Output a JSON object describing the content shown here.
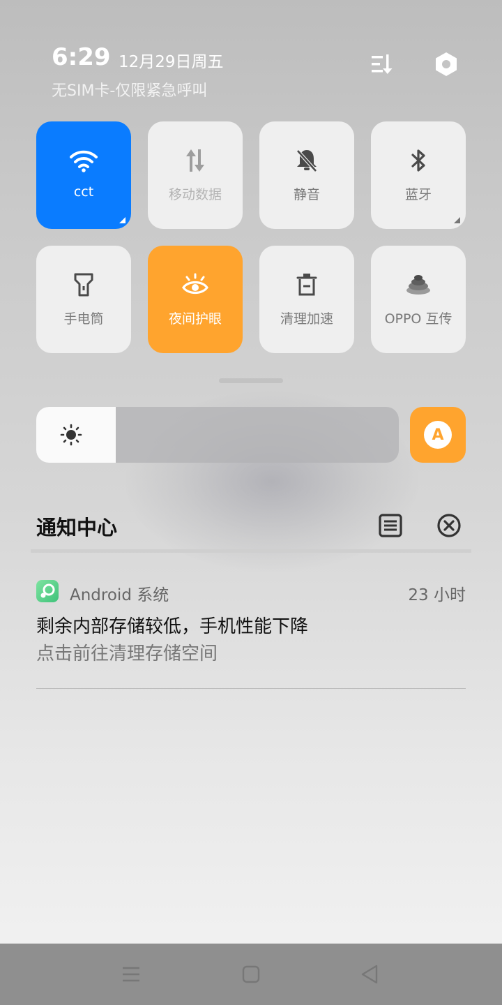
{
  "status": {
    "time": "6:29",
    "date": "12月29日周五",
    "carrier": "无SIM卡-仅限紧急呼叫",
    "icons": [
      "edit-sort-icon",
      "settings-gear-icon"
    ]
  },
  "tiles": [
    {
      "label": "cct",
      "icon": "wifi-icon",
      "state": "active-blue"
    },
    {
      "label": "移动数据",
      "icon": "mobile-data-icon",
      "state": "disabled"
    },
    {
      "label": "静音",
      "icon": "mute-bell-icon",
      "state": "off"
    },
    {
      "label": "蓝牙",
      "icon": "bluetooth-icon",
      "state": "off"
    },
    {
      "label": "手电筒",
      "icon": "flashlight-icon",
      "state": "off"
    },
    {
      "label": "夜间护眼",
      "icon": "eye-protection-icon",
      "state": "active-orange"
    },
    {
      "label": "清理加速",
      "icon": "trash-icon",
      "state": "off"
    },
    {
      "label": "OPPO 互传",
      "icon": "oppo-share-icon",
      "state": "off"
    }
  ],
  "brightness": {
    "level": 0.22,
    "auto_label": "A"
  },
  "notification_center": {
    "title": "通知中心",
    "icons": [
      "manage-notifications-icon",
      "clear-all-icon"
    ]
  },
  "notification": {
    "app": "Android 系统",
    "time": "23 小时",
    "title": "剩余内部存储较低，手机性能下降",
    "body": "点击前往清理存储空间"
  },
  "colors": {
    "accent_blue": "#0a7cff",
    "accent_orange": "#ffa42e",
    "tile_bg": "#efefef"
  },
  "navbar": {
    "icons": [
      "menu-icon",
      "home-icon",
      "back-icon"
    ]
  }
}
